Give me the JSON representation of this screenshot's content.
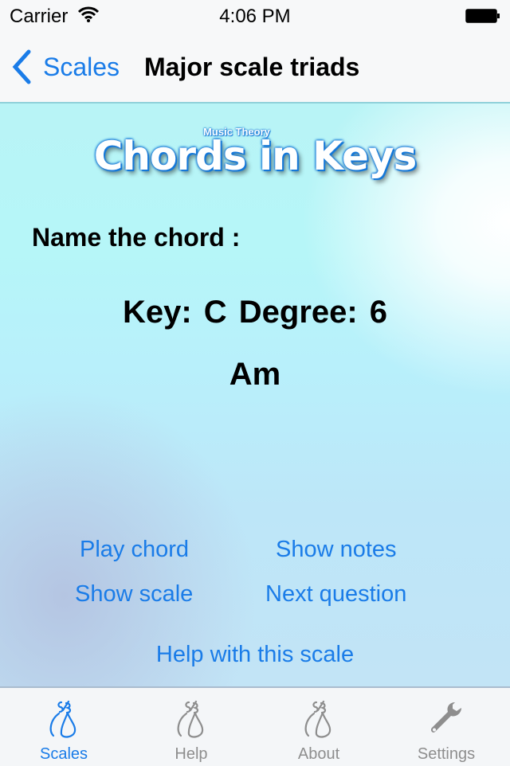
{
  "status_bar": {
    "carrier": "Carrier",
    "time": "4:06 PM",
    "wifi_icon": "wifi-icon",
    "battery_icon": "battery-icon"
  },
  "nav": {
    "back_label": "Scales",
    "back_icon": "chevron-left-icon",
    "title": "Major scale triads"
  },
  "logo": {
    "subtitle": "Music Theory",
    "title": "Chords in Keys"
  },
  "quiz": {
    "prompt": "Name the chord :",
    "question": "Key: C  Degree: 6",
    "answer": "Am"
  },
  "actions": {
    "play_chord": "Play chord",
    "show_notes": "Show notes",
    "show_scale": "Show scale",
    "next_question": "Next question",
    "help_scale": "Help with this scale"
  },
  "tab_bar": {
    "tabs": [
      {
        "label": "Scales",
        "icon": "violin-icon",
        "active": true
      },
      {
        "label": "Help",
        "icon": "violin-icon",
        "active": false
      },
      {
        "label": "About",
        "icon": "violin-icon",
        "active": false
      },
      {
        "label": "Settings",
        "icon": "wrench-icon",
        "active": false
      }
    ]
  },
  "colors": {
    "accent": "#1a7ce8",
    "inactive_tab": "#8e8e8e"
  }
}
